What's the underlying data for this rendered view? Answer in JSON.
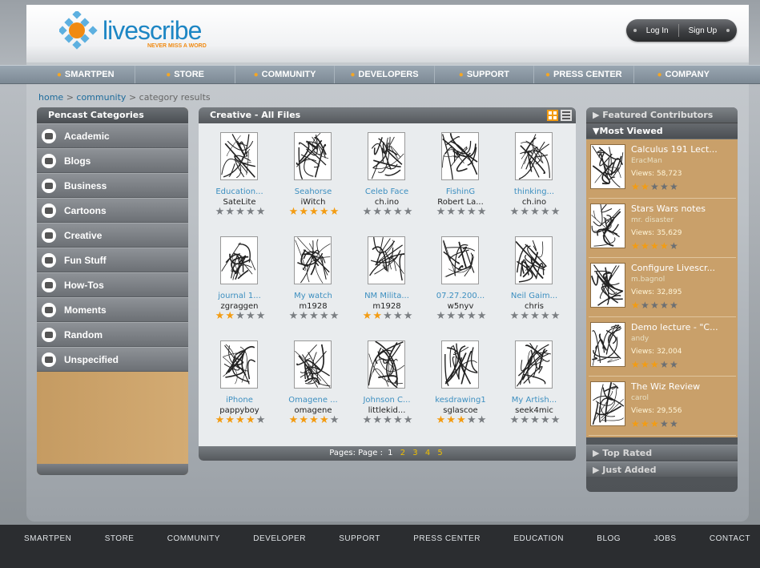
{
  "header": {
    "logo_text": "livescribe",
    "logo_tagline": "NEVER MISS A WORD",
    "login_label": "Log In",
    "signup_label": "Sign Up"
  },
  "nav": {
    "items": [
      "SMARTPEN",
      "STORE",
      "COMMUNITY",
      "DEVELOPERS",
      "SUPPORT",
      "PRESS CENTER",
      "COMPANY"
    ]
  },
  "breadcrumb": {
    "home": "home",
    "community": "community",
    "current": "category results",
    "sep": ">"
  },
  "categories": {
    "title": "Pencast Categories",
    "items": [
      "Academic",
      "Blogs",
      "Business",
      "Cartoons",
      "Creative",
      "Fun Stuff",
      "How-Tos",
      "Moments",
      "Random",
      "Unspecified"
    ]
  },
  "center": {
    "title": "Creative - All Files",
    "files": [
      {
        "title": "Education...",
        "user": "SateLite",
        "rating": 0
      },
      {
        "title": "Seahorse",
        "user": "iWitch",
        "rating": 5
      },
      {
        "title": "Celeb Face",
        "user": "ch.ino",
        "rating": 0
      },
      {
        "title": "FishinG",
        "user": "Robert La...",
        "rating": 0
      },
      {
        "title": "thinking...",
        "user": "ch.ino",
        "rating": 0
      },
      {
        "title": "journal 1...",
        "user": "zgraggen",
        "rating": 2
      },
      {
        "title": "My watch",
        "user": "m1928",
        "rating": 0
      },
      {
        "title": "NM Milita...",
        "user": "m1928",
        "rating": 2
      },
      {
        "title": "07.27.200...",
        "user": "w5nyv",
        "rating": 0
      },
      {
        "title": "Neil Gaim...",
        "user": "chris",
        "rating": 0
      },
      {
        "title": "iPhone",
        "user": "pappyboy",
        "rating": 4
      },
      {
        "title": "Omagene ...",
        "user": "omagene",
        "rating": 4
      },
      {
        "title": "Johnson C...",
        "user": "littlekid...",
        "rating": 0
      },
      {
        "title": "kesdrawing1",
        "user": "sglascoe",
        "rating": 3
      },
      {
        "title": "My Artish...",
        "user": "seek4mic",
        "rating": 0
      }
    ],
    "pages_label": "Pages: Page :",
    "pages": [
      "1",
      "2",
      "3",
      "4",
      "5"
    ],
    "current_page": "1"
  },
  "right": {
    "featured_label": "Featured Contributors",
    "most_viewed_label": "Most Viewed",
    "items": [
      {
        "title": "Calculus 191 Lect...",
        "author": "EracMan",
        "views": "Views: 58,723",
        "rating": 2
      },
      {
        "title": "Stars Wars notes",
        "author": "mr. disaster",
        "views": "Views: 35,629",
        "rating": 3.5
      },
      {
        "title": "Configure Livescr...",
        "author": "m.bagnol",
        "views": "Views: 32,895",
        "rating": 1
      },
      {
        "title": "Demo lecture - \"C...",
        "author": "andy",
        "views": "Views: 32,004",
        "rating": 3
      },
      {
        "title": "The Wiz Review",
        "author": "carol",
        "views": "Views: 29,556",
        "rating": 2.5
      }
    ],
    "top_rated_label": "Top Rated",
    "just_added_label": "Just Added"
  },
  "footer": {
    "items": [
      "SMARTPEN",
      "STORE",
      "COMMUNITY",
      "DEVELOPER",
      "SUPPORT",
      "PRESS CENTER",
      "EDUCATION",
      "BLOG",
      "JOBS",
      "CONTACT"
    ]
  },
  "colors": {
    "accent": "#f39c12",
    "link": "#3d8fc0",
    "panel_tan": "#c9a06a",
    "brand_blue": "#1d86c4"
  }
}
